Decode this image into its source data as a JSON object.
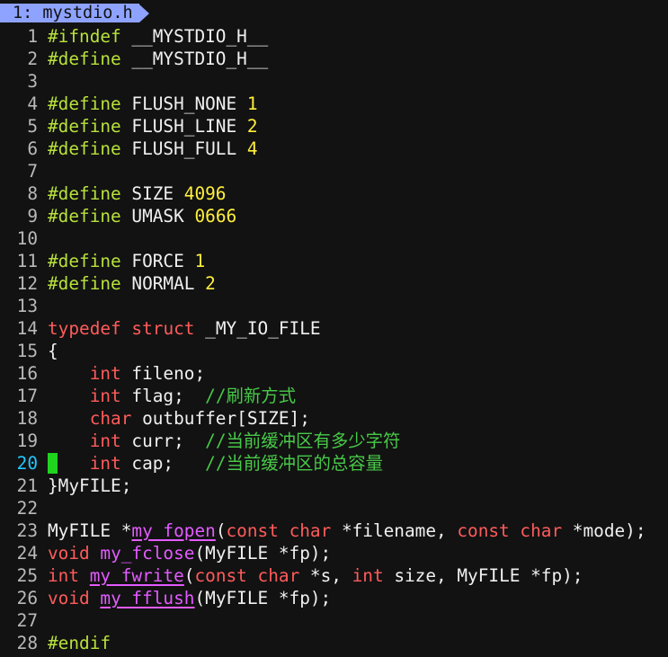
{
  "tab": {
    "label": "1: mystdio.h"
  },
  "colors": {
    "background": "#121212",
    "preprocessor": "#b8e23a",
    "number": "#ffef3b",
    "keyword": "#ff5b5b",
    "function": "#e35bff",
    "comment": "#48c948",
    "cursor": "#1fd31f",
    "current_line_number": "#22c7ff"
  },
  "cursor_line": 20,
  "lines": [
    {
      "n": "1",
      "t": [
        [
          "pp",
          "#ifndef"
        ],
        [
          "plain",
          " __MYSTDIO_H__"
        ]
      ]
    },
    {
      "n": "2",
      "t": [
        [
          "pp",
          "#define"
        ],
        [
          "plain",
          " __MYSTDIO_H__"
        ]
      ]
    },
    {
      "n": "3",
      "t": []
    },
    {
      "n": "4",
      "t": [
        [
          "pp",
          "#define"
        ],
        [
          "plain",
          " FLUSH_NONE "
        ],
        [
          "num",
          "1"
        ]
      ]
    },
    {
      "n": "5",
      "t": [
        [
          "pp",
          "#define"
        ],
        [
          "plain",
          " FLUSH_LINE "
        ],
        [
          "num",
          "2"
        ]
      ]
    },
    {
      "n": "6",
      "t": [
        [
          "pp",
          "#define"
        ],
        [
          "plain",
          " FLUSH_FULL "
        ],
        [
          "num",
          "4"
        ]
      ]
    },
    {
      "n": "7",
      "t": []
    },
    {
      "n": "8",
      "t": [
        [
          "pp",
          "#define"
        ],
        [
          "plain",
          " SIZE "
        ],
        [
          "num",
          "4096"
        ]
      ]
    },
    {
      "n": "9",
      "t": [
        [
          "pp",
          "#define"
        ],
        [
          "plain",
          " UMASK "
        ],
        [
          "num",
          "0666"
        ]
      ]
    },
    {
      "n": "10",
      "t": []
    },
    {
      "n": "11",
      "t": [
        [
          "pp",
          "#define"
        ],
        [
          "plain",
          " FORCE "
        ],
        [
          "num",
          "1"
        ]
      ]
    },
    {
      "n": "12",
      "t": [
        [
          "pp",
          "#define"
        ],
        [
          "plain",
          " NORMAL "
        ],
        [
          "num",
          "2"
        ]
      ]
    },
    {
      "n": "13",
      "t": []
    },
    {
      "n": "14",
      "t": [
        [
          "kw",
          "typedef"
        ],
        [
          "plain",
          " "
        ],
        [
          "kw",
          "struct"
        ],
        [
          "plain",
          " _MY_IO_FILE"
        ]
      ]
    },
    {
      "n": "15",
      "t": [
        [
          "plain",
          "{"
        ]
      ]
    },
    {
      "n": "16",
      "t": [
        [
          "plain",
          "    "
        ],
        [
          "kw",
          "int"
        ],
        [
          "plain",
          " fileno;"
        ]
      ]
    },
    {
      "n": "17",
      "t": [
        [
          "plain",
          "    "
        ],
        [
          "kw",
          "int"
        ],
        [
          "plain",
          " flag;  "
        ],
        [
          "cm",
          "//刷新方式"
        ]
      ]
    },
    {
      "n": "18",
      "t": [
        [
          "plain",
          "    "
        ],
        [
          "kw",
          "char"
        ],
        [
          "plain",
          " outbuffer[SIZE];"
        ]
      ]
    },
    {
      "n": "19",
      "t": [
        [
          "plain",
          "    "
        ],
        [
          "kw",
          "int"
        ],
        [
          "plain",
          " curr;  "
        ],
        [
          "cm",
          "//当前缓冲区有多少字符"
        ]
      ]
    },
    {
      "n": "20",
      "t": [
        [
          "plain",
          "    "
        ],
        [
          "kw",
          "int"
        ],
        [
          "plain",
          " cap;   "
        ],
        [
          "cm",
          "//当前缓冲区的总容量"
        ]
      ]
    },
    {
      "n": "21",
      "t": [
        [
          "plain",
          "}MyFILE;"
        ]
      ]
    },
    {
      "n": "22",
      "t": []
    },
    {
      "n": "23",
      "t": [
        [
          "plain",
          "MyFILE *"
        ],
        [
          "fnu",
          "my_fopen"
        ],
        [
          "plain",
          "("
        ],
        [
          "kw",
          "const"
        ],
        [
          "plain",
          " "
        ],
        [
          "kw",
          "char"
        ],
        [
          "plain",
          " *filename, "
        ],
        [
          "kw",
          "const"
        ],
        [
          "plain",
          " "
        ],
        [
          "kw",
          "char"
        ],
        [
          "plain",
          " *mode);"
        ]
      ]
    },
    {
      "n": "24",
      "t": [
        [
          "kw",
          "void"
        ],
        [
          "plain",
          " "
        ],
        [
          "fn",
          "my_fclose"
        ],
        [
          "plain",
          "(MyFILE *fp);"
        ]
      ]
    },
    {
      "n": "25",
      "t": [
        [
          "kw",
          "int"
        ],
        [
          "plain",
          " "
        ],
        [
          "fnu",
          "my_fwrite"
        ],
        [
          "plain",
          "("
        ],
        [
          "kw",
          "const"
        ],
        [
          "plain",
          " "
        ],
        [
          "kw",
          "char"
        ],
        [
          "plain",
          " *s, "
        ],
        [
          "kw",
          "int"
        ],
        [
          "plain",
          " size, MyFILE *fp);"
        ]
      ]
    },
    {
      "n": "26",
      "t": [
        [
          "kw",
          "void"
        ],
        [
          "plain",
          " "
        ],
        [
          "fnu",
          "my_fflush"
        ],
        [
          "plain",
          "(MyFILE *fp);"
        ]
      ]
    },
    {
      "n": "27",
      "t": []
    },
    {
      "n": "28",
      "t": [
        [
          "pp",
          "#endif"
        ]
      ]
    }
  ]
}
